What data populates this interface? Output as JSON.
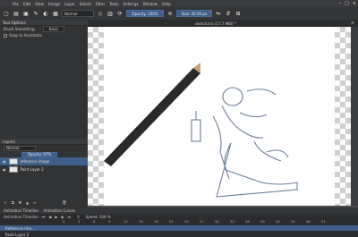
{
  "menubar": {
    "items": [
      "File",
      "Edit",
      "View",
      "Image",
      "Layer",
      "Select",
      "Filter",
      "Tools",
      "Settings",
      "Window",
      "Help"
    ]
  },
  "toolbar": {
    "blend_mode": "Normal",
    "opacity_label": "Opacity: 100%",
    "size_label": "Size: 40.00 px"
  },
  "tool_options": {
    "title": "Tool Options",
    "brush_smoothing_label": "Brush Smoothing:",
    "brush_smoothing_value": "Basic",
    "snap_label": "Snap to Assistants"
  },
  "document": {
    "tab_title": "sketch.kra (17.7 MiB) *"
  },
  "layers": {
    "title": "Layers",
    "blend_mode": "Normal",
    "opacity_label": "Opacity: 67%",
    "items": [
      {
        "name": "reference image",
        "selected": true
      },
      {
        "name": "Paint Layer 2",
        "selected": false
      }
    ]
  },
  "animation": {
    "tabs": [
      "Animation Timeline",
      "Animation Curves"
    ],
    "subtab": "Animation Timeline",
    "frame_value": "0",
    "speed_label": "Speed: 100 %",
    "ruler": [
      "0",
      "3",
      "6",
      "9",
      "12",
      "15",
      "18",
      "21",
      "24",
      "27",
      "30",
      "33",
      "36",
      "39",
      "42",
      "45",
      "48",
      "51"
    ],
    "tracks": [
      {
        "name": "Reference Ima..."
      },
      {
        "name": "Paint Layer 2"
      }
    ]
  }
}
